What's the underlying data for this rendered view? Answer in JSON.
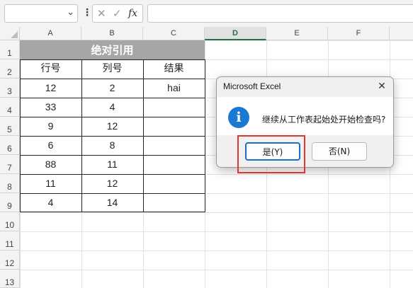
{
  "formula_bar": {
    "name_box_value": "",
    "dots": "⋮",
    "cancel_icon": "✕",
    "enter_icon": "✓",
    "fx_label": "fx",
    "formula_value": ""
  },
  "grid": {
    "columns": [
      "A",
      "B",
      "C",
      "D",
      "E",
      "F"
    ],
    "selected_column": "D",
    "rows": [
      "1",
      "2",
      "3",
      "4",
      "5",
      "6",
      "7",
      "8",
      "9",
      "10",
      "11",
      "12",
      "13"
    ]
  },
  "table": {
    "title": "绝对引用",
    "headers": [
      "行号",
      "列号",
      "结果"
    ],
    "rows": [
      [
        "12",
        "2",
        "hai"
      ],
      [
        "33",
        "4",
        ""
      ],
      [
        "9",
        "12",
        ""
      ],
      [
        "6",
        "8",
        ""
      ],
      [
        "88",
        "11",
        ""
      ],
      [
        "11",
        "12",
        ""
      ],
      [
        "4",
        "14",
        ""
      ]
    ]
  },
  "dialog": {
    "title": "Microsoft Excel",
    "close_label": "✕",
    "info_glyph": "i",
    "message": "继续从工作表起始处开始检查吗?",
    "yes_label": "是(Y)",
    "no_label": "否(N)"
  },
  "colors": {
    "title_fill": "#a6a6a6",
    "info_blue": "#1a7ad1",
    "highlight_red": "#e0362c",
    "selected_header_green": "#217346"
  }
}
